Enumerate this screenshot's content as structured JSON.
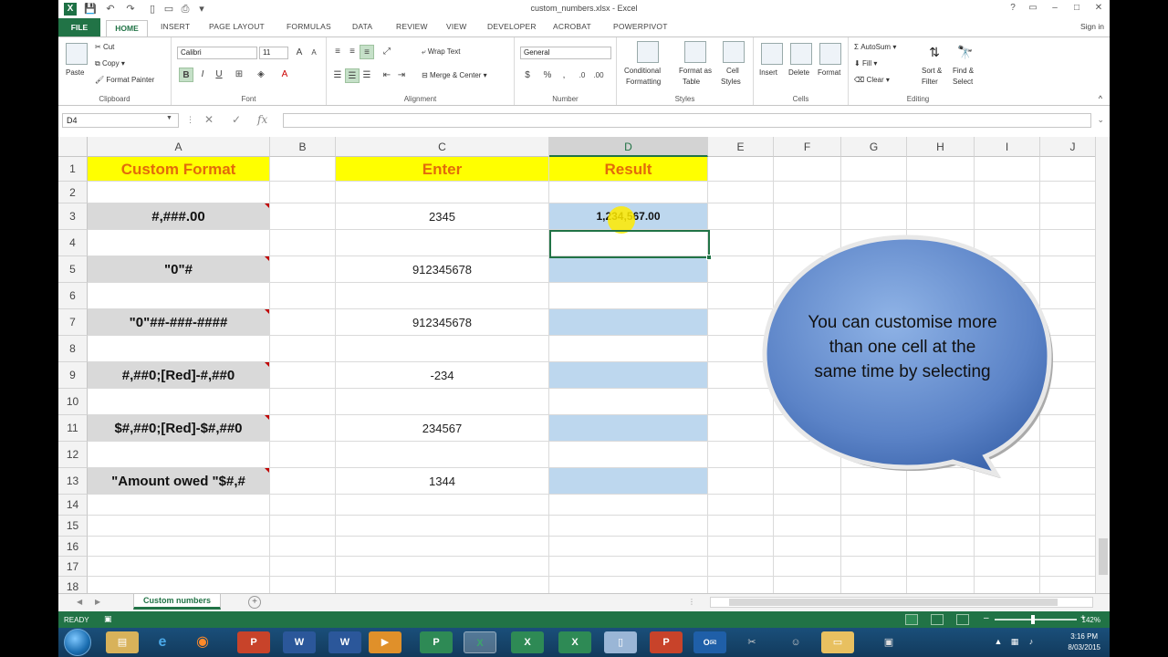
{
  "window": {
    "title": "custom_numbers.xlsx - Excel",
    "signin": "Sign in",
    "controls": [
      "?",
      "▭",
      "–",
      "□",
      "✕"
    ]
  },
  "tabs": [
    "FILE",
    "HOME",
    "INSERT",
    "PAGE LAYOUT",
    "FORMULAS",
    "DATA",
    "REVIEW",
    "VIEW",
    "DEVELOPER",
    "ACROBAT",
    "POWERPIVOT"
  ],
  "ribbon": {
    "clipboard": {
      "label": "Clipboard",
      "paste": "Paste",
      "cut": "Cut",
      "copy": "Copy",
      "format_painter": "Format Painter"
    },
    "font": {
      "label": "Font",
      "name": "Calibri",
      "size": "11"
    },
    "alignment": {
      "label": "Alignment",
      "wrap_text": "Wrap Text",
      "merge_center": "Merge & Center"
    },
    "number": {
      "label": "Number",
      "format": "General"
    },
    "styles": {
      "label": "Styles",
      "conditional": "Conditional",
      "conditional2": "Formatting",
      "format_table": "Format as",
      "format_table2": "Table",
      "cell_styles": "Cell",
      "cell_styles2": "Styles"
    },
    "cells": {
      "label": "Cells",
      "insert": "Insert",
      "delete": "Delete",
      "format": "Format"
    },
    "editing": {
      "label": "Editing",
      "autosum": "AutoSum",
      "fill": "Fill",
      "clear": "Clear",
      "sort_filter": "Sort &",
      "sort_filter2": "Filter",
      "find_select": "Find &",
      "find_select2": "Select"
    }
  },
  "formula_bar": {
    "name_box": "D4",
    "value": ""
  },
  "columns": [
    "A",
    "B",
    "C",
    "D",
    "E",
    "F",
    "G",
    "H",
    "I",
    "J"
  ],
  "rows": [
    "1",
    "2",
    "3",
    "4",
    "5",
    "6",
    "7",
    "8",
    "9",
    "10",
    "11",
    "12",
    "13",
    "14",
    "15",
    "16",
    "17",
    "18"
  ],
  "cells": {
    "A1": "Custom Format",
    "C1": "Enter",
    "D1": "Result",
    "A3": "#,###.00",
    "C3": "2345",
    "D3": "1,234,567.00",
    "A5": "\"0\"#",
    "C5": "912345678",
    "A7": "\"0\"##-###-####",
    "C7": "912345678",
    "A9": "#,##0;[Red]-#,##0",
    "C9": "-234",
    "A11": "$#,##0;[Red]-$#,##0",
    "C11": "234567",
    "A13": "\"Amount owed \"$#,#",
    "C13": "1344"
  },
  "callout": {
    "text": "You can customise more than one cell at the same time by selecting"
  },
  "sheet_tab": "Custom numbers",
  "status": {
    "ready": "READY",
    "zoom": "142%"
  },
  "clock": {
    "time": "3:16 PM",
    "date": "8/03/2015"
  },
  "colors": {
    "excel_green": "#217346",
    "header_yellow": "#ffff00",
    "header_text": "#e26b0a",
    "format_gray": "#d9d9d9",
    "result_blue": "#bdd7ee"
  },
  "icons": [
    "excel-logo",
    "save-icon",
    "undo-icon",
    "redo-icon",
    "paste-icon",
    "cut-icon",
    "copy-icon",
    "format-painter-icon",
    "bold-icon",
    "italic-icon",
    "underline-icon",
    "cancel-icon",
    "check-icon",
    "fx-icon",
    "autosum-icon",
    "sort-icon",
    "find-icon",
    "start-icon"
  ]
}
